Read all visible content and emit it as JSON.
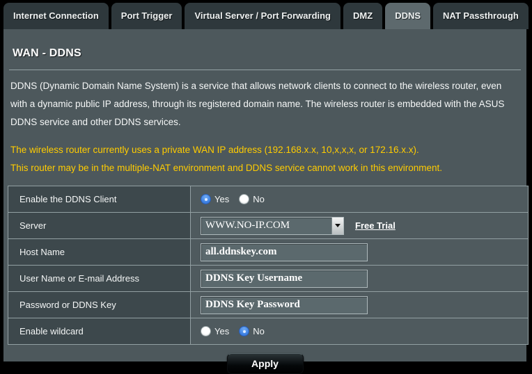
{
  "tabs": [
    {
      "label": "Internet Connection",
      "active": false
    },
    {
      "label": "Port Trigger",
      "active": false
    },
    {
      "label": "Virtual Server / Port Forwarding",
      "active": false
    },
    {
      "label": "DMZ",
      "active": false
    },
    {
      "label": "DDNS",
      "active": true
    },
    {
      "label": "NAT Passthrough",
      "active": false
    }
  ],
  "page": {
    "title": "WAN - DDNS",
    "description": "DDNS (Dynamic Domain Name System) is a service that allows network clients to connect to the wireless router, even with a dynamic public IP address, through its registered domain name. The wireless router is embedded with the ASUS DDNS service and other DDNS services.",
    "warning_line1": "The wireless router currently uses a private WAN IP address (192.168.x.x, 10,x,x,x, or 172.16.x.x).",
    "warning_line2": "This router may be in the multiple-NAT environment and DDNS service cannot work in this environment."
  },
  "form": {
    "enable_ddns": {
      "label": "Enable the DDNS Client",
      "yes_label": "Yes",
      "no_label": "No",
      "selected": "Yes"
    },
    "server": {
      "label": "Server",
      "value": "WWW.NO-IP.COM",
      "link_label": "Free Trial"
    },
    "host_name": {
      "label": "Host Name",
      "value": "all.ddnskey.com"
    },
    "username": {
      "label": "User Name or E-mail Address",
      "value": "DDNS Key Username"
    },
    "password": {
      "label": "Password or DDNS Key",
      "value": "DDNS Key Password"
    },
    "wildcard": {
      "label": "Enable wildcard",
      "yes_label": "Yes",
      "no_label": "No",
      "selected": "No"
    }
  },
  "apply": {
    "label": "Apply"
  },
  "colors": {
    "accent_radio": "#3a7de0",
    "warning_text": "#ffcc00",
    "panel_bg": "#4d585c",
    "label_cell_bg": "#3d484c",
    "value_cell_bg": "#4f5a5e",
    "tab_inactive_bg": "#2e383c",
    "tab_active_bg": "#5d696d"
  }
}
